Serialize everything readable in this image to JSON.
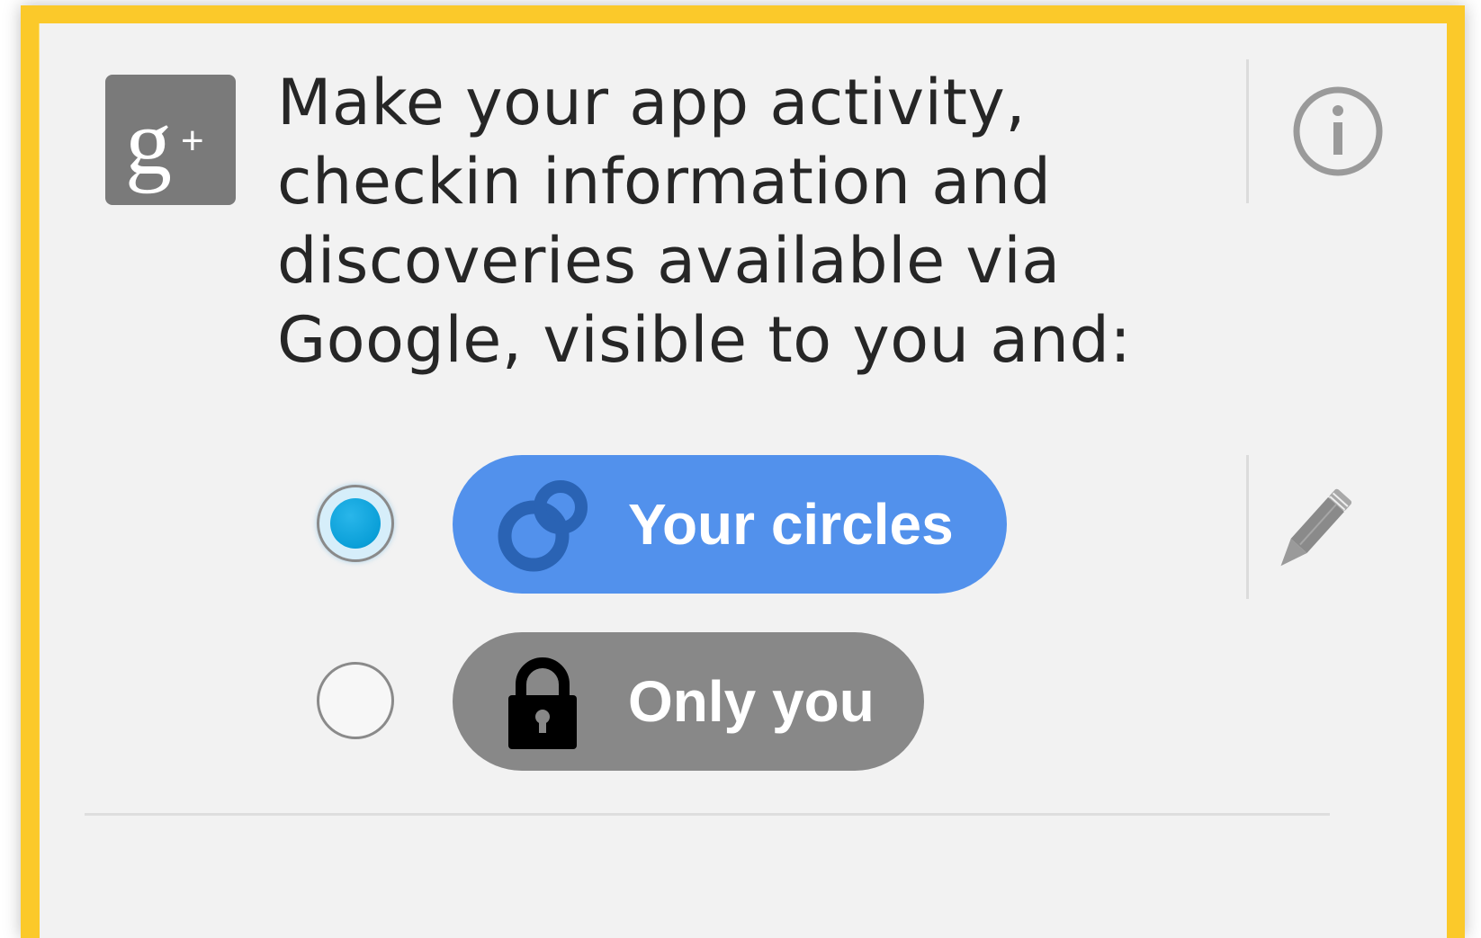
{
  "dialog": {
    "message": "Make your app activity, checkin information and discoveries available via Google, visible to you and:"
  },
  "visibility_options": [
    {
      "label": "Your circles",
      "selected": true,
      "icon": "circles-icon",
      "color": "#5291ec"
    },
    {
      "label": "Only you",
      "selected": false,
      "icon": "lock-icon",
      "color": "#888888"
    }
  ],
  "icons": {
    "logo": "google-plus-icon",
    "info": "info-icon",
    "edit": "pencil-icon"
  },
  "colors": {
    "frame": "#fbc92a",
    "card_background": "#f2f2f2",
    "radio_selected": "#0a9fd8"
  }
}
